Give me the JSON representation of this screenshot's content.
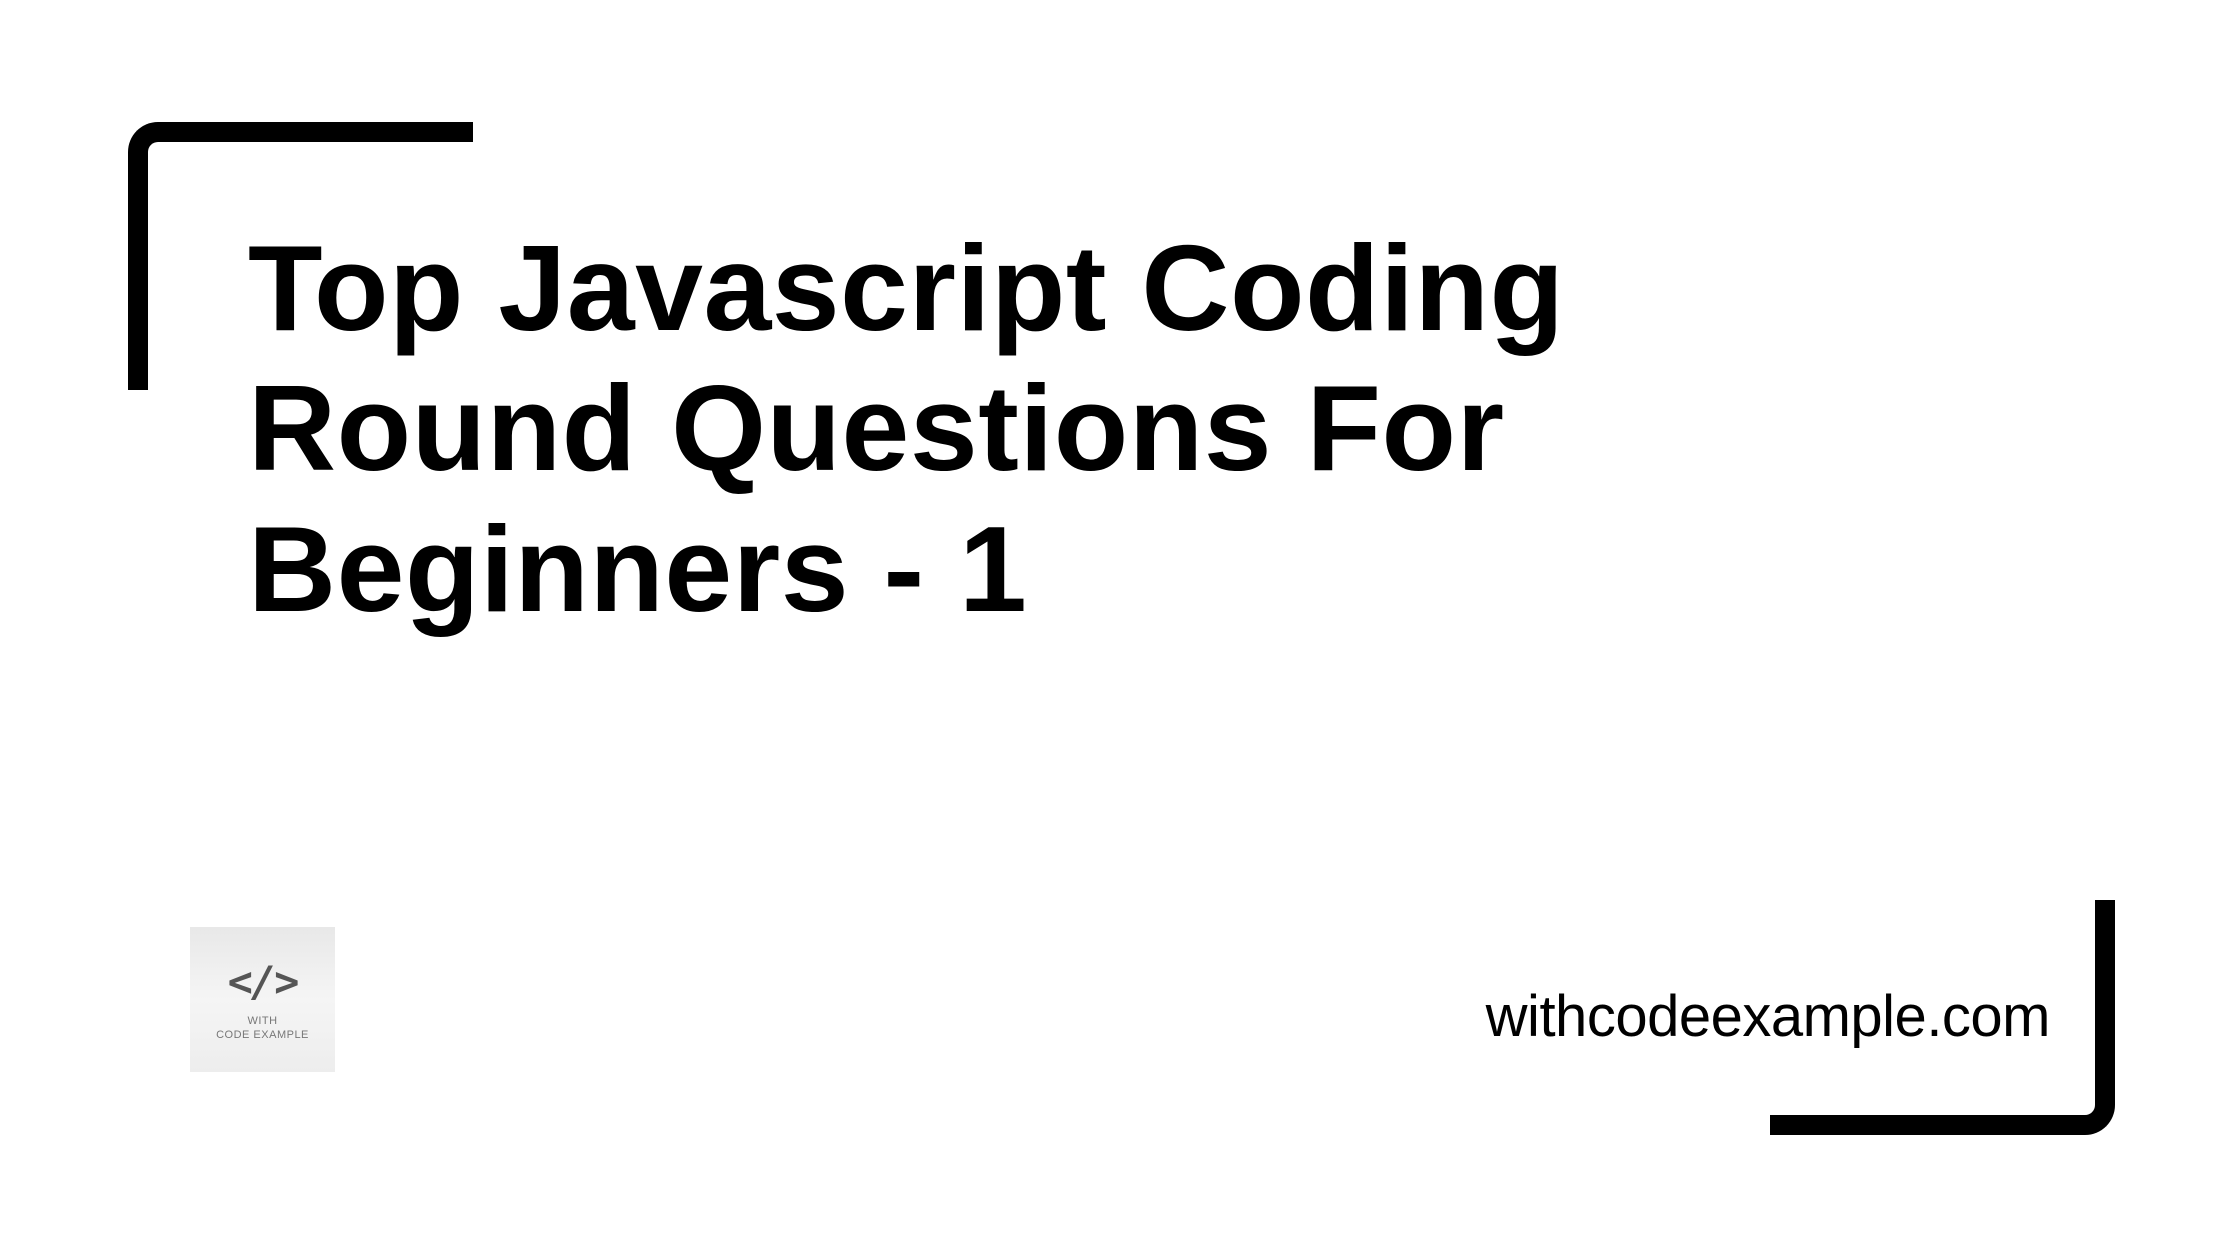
{
  "title": "Top Javascript Coding Round Questions For Beginners - 1",
  "logo": {
    "icon": "</>",
    "line1": "WITH",
    "line2": "CODE EXAMPLE"
  },
  "website": "withcodeexample.com"
}
